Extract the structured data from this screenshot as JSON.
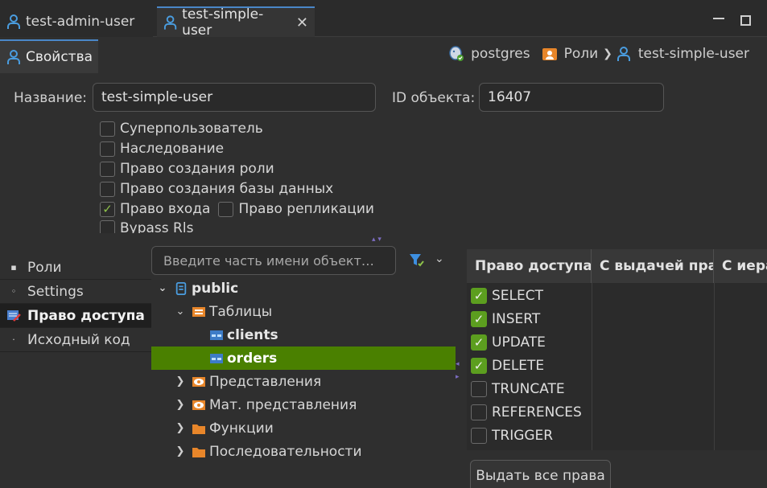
{
  "tabs": [
    {
      "label": "test-admin-user",
      "active": false
    },
    {
      "label": "test-simple-user",
      "active": true
    }
  ],
  "subbar": {
    "properties_tab": "Свойства",
    "crumbs": {
      "connection": "postgres",
      "folder": "Роли",
      "object": "test-simple-user"
    }
  },
  "form": {
    "name_label": "Название:",
    "name_value": "test-simple-user",
    "id_label": "ID объекта:",
    "id_value": "16407",
    "checkboxes": [
      {
        "label": "Суперпользователь",
        "checked": false
      },
      {
        "label": "Наследование",
        "checked": false
      },
      {
        "label": "Право создания роли",
        "checked": false
      },
      {
        "label": "Право создания базы данных",
        "checked": false
      },
      {
        "label": "Право входа",
        "checked": true
      },
      {
        "label": "Право репликации",
        "checked": false
      },
      {
        "label": "Bypass Rls",
        "checked": false
      }
    ]
  },
  "side_tabs": [
    {
      "label": "Роли",
      "selected": false
    },
    {
      "label": "Settings",
      "selected": false
    },
    {
      "label": "Право доступа",
      "selected": true
    },
    {
      "label": "Исходный код",
      "selected": false
    }
  ],
  "search": {
    "placeholder": "Введите часть имени объект…"
  },
  "tree": [
    {
      "label": "public",
      "level": 0,
      "twisty": "open",
      "icon": "schema-icon",
      "bold": true
    },
    {
      "label": "Таблицы",
      "level": 1,
      "twisty": "open",
      "icon": "tables-folder-icon",
      "bold": false
    },
    {
      "label": "clients",
      "level": 2,
      "twisty": "none",
      "icon": "table-icon",
      "bold": true
    },
    {
      "label": "orders",
      "level": 2,
      "twisty": "none",
      "icon": "table-icon",
      "bold": true,
      "selected": true
    },
    {
      "label": "Представления",
      "level": 1,
      "twisty": "closed",
      "icon": "view-icon",
      "bold": false
    },
    {
      "label": "Мат. представления",
      "level": 1,
      "twisty": "closed",
      "icon": "view-icon",
      "bold": false
    },
    {
      "label": "Функции",
      "level": 1,
      "twisty": "closed",
      "icon": "folder-icon",
      "bold": false
    },
    {
      "label": "Последовательности",
      "level": 1,
      "twisty": "closed",
      "icon": "folder-icon",
      "bold": false
    }
  ],
  "grid": {
    "headers": [
      "Право доступа",
      "С выдачей прав",
      "С иерархией"
    ],
    "rows": [
      {
        "label": "SELECT",
        "checked": true
      },
      {
        "label": "INSERT",
        "checked": true
      },
      {
        "label": "UPDATE",
        "checked": true
      },
      {
        "label": "DELETE",
        "checked": true
      },
      {
        "label": "TRUNCATE",
        "checked": false
      },
      {
        "label": "REFERENCES",
        "checked": false
      },
      {
        "label": "TRIGGER",
        "checked": false
      }
    ]
  },
  "grant_all_button": "Выдать все права",
  "colors": {
    "accent": "#4a87c8",
    "selection": "#4a8000",
    "check": "#5c9e1f",
    "folder": "#e8862a"
  }
}
